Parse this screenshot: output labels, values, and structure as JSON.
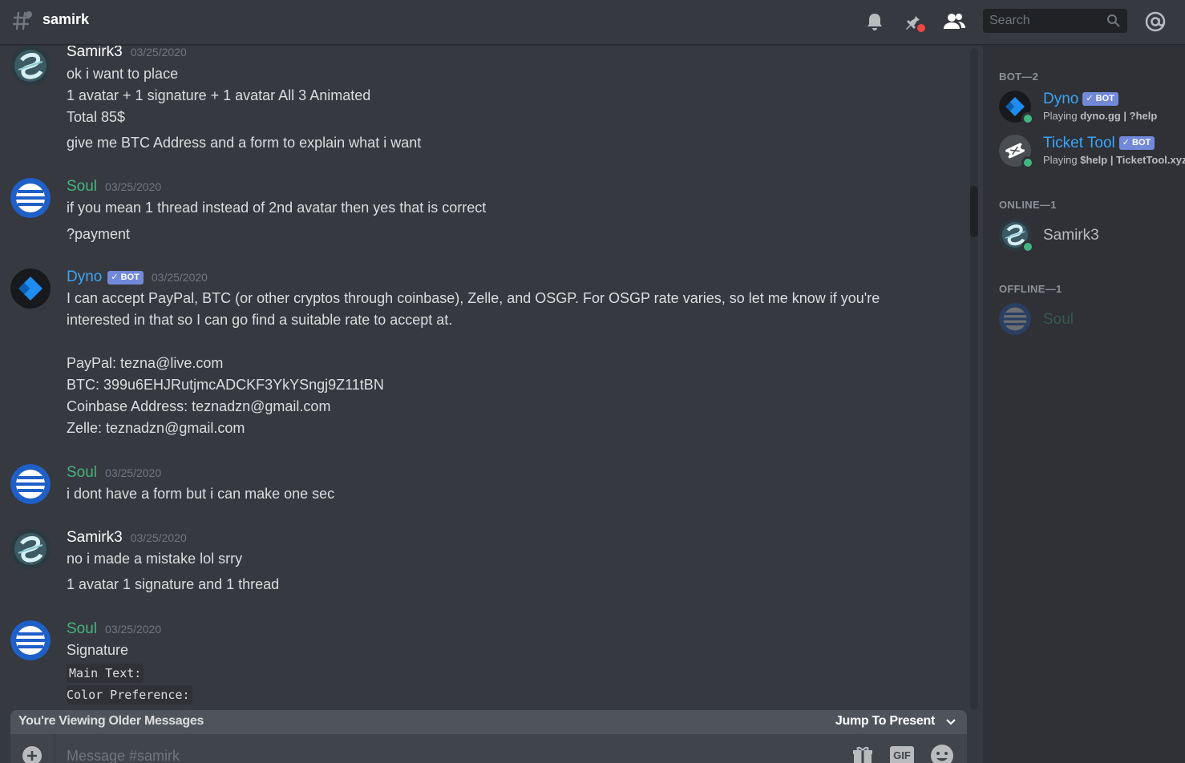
{
  "header": {
    "channel_name": "samirk",
    "search_placeholder": "Search"
  },
  "messages": [
    {
      "author": "Samirk3",
      "author_color": "#ffffff",
      "timestamp": "03/25/2020",
      "bot": false,
      "lines": [
        "ok i want to place",
        "1 avatar + 1 signature + 1 avatar All 3 Animated",
        "Total 85$",
        "give me BTC Address and a form to explain what i want"
      ]
    },
    {
      "author": "Soul",
      "author_color": "#43b581",
      "timestamp": "03/25/2020",
      "bot": false,
      "lines": [
        "if you mean 1 thread instead of 2nd avatar then yes that is correct",
        "?payment"
      ]
    },
    {
      "author": "Dyno",
      "author_color": "#3ba4f5",
      "timestamp": "03/25/2020",
      "bot": true,
      "bot_label": "BOT",
      "lines": [
        "I can accept PayPal, BTC (or other cryptos through coinbase), Zelle, and OSGP. For OSGP rate varies, so let me know if you're",
        "interested in that so I can go find a suitable rate to accept at.",
        "PayPal: tezna@live.com",
        "BTC: 399u6EHJRutjmcADCKF3YkYSngj9Z11tBN",
        "Coinbase Address: teznadzn@gmail.com",
        "Zelle: teznadzn@gmail.com"
      ]
    },
    {
      "author": "Soul",
      "author_color": "#43b581",
      "timestamp": "03/25/2020",
      "bot": false,
      "lines": [
        "i dont have a form but i can make one sec"
      ]
    },
    {
      "author": "Samirk3",
      "author_color": "#ffffff",
      "timestamp": "03/25/2020",
      "bot": false,
      "lines": [
        "no i made a mistake lol srry",
        "1 avatar 1 signature and 1 thread"
      ]
    },
    {
      "author": "Soul",
      "author_color": "#43b581",
      "timestamp": "03/25/2020",
      "bot": false,
      "lines": [
        "Signature"
      ],
      "code_lines": [
        "Main Text:",
        "Color Preference:"
      ]
    }
  ],
  "older_bar": {
    "viewing_text": "You're Viewing Older Messages",
    "jump_text": "Jump To Present"
  },
  "composer": {
    "placeholder": "Message #samirk",
    "gif_label": "GIF"
  },
  "members": {
    "groups": [
      {
        "header": "BOT—2",
        "members": [
          {
            "name": "Dyno",
            "color": "#3ba4f5",
            "bot_label": "BOT",
            "activity_prefix": "Playing ",
            "activity": "dyno.gg | ?help",
            "status": "online"
          },
          {
            "name": "Ticket Tool",
            "color": "#3ba4f5",
            "bot_label": "BOT",
            "activity_prefix": "Playing ",
            "activity": "$help | TicketTool.xyz",
            "status": "online"
          }
        ]
      },
      {
        "header": "ONLINE—1",
        "members": [
          {
            "name": "Samirk3",
            "color": "#b9bbbe",
            "status": "online"
          }
        ]
      },
      {
        "header": "OFFLINE—1",
        "members": [
          {
            "name": "Soul",
            "color": "#43b581",
            "status": "offline"
          }
        ]
      }
    ]
  },
  "colors": {
    "background": "#36393f",
    "sidebar": "#2f3136",
    "green": "#43b581",
    "blurple": "#7289da",
    "link_blue": "#3ba4f5"
  }
}
